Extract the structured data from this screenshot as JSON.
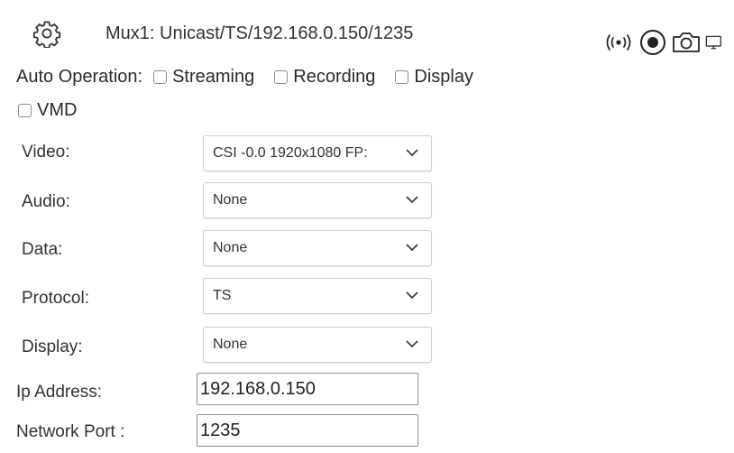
{
  "header": {
    "title": "Mux1: Unicast/TS/192.168.0.150/1235",
    "settings_icon": "gear-icon",
    "status_icons": [
      "broadcast-icon",
      "record-icon",
      "camera-icon",
      "monitor-icon"
    ]
  },
  "auto_operation": {
    "label": "Auto Operation:",
    "options": [
      {
        "label": "Streaming",
        "checked": false
      },
      {
        "label": "Recording",
        "checked": false
      },
      {
        "label": "Display",
        "checked": false
      },
      {
        "label": "VMD",
        "checked": false
      }
    ]
  },
  "fields": {
    "video": {
      "label": "Video:",
      "value": "CSI -0.0 1920x1080 FP:"
    },
    "audio": {
      "label": "Audio:",
      "value": "None"
    },
    "data": {
      "label": "Data:",
      "value": "None"
    },
    "protocol": {
      "label": "Protocol:",
      "value": "TS"
    },
    "display": {
      "label": "Display:",
      "value": "None"
    },
    "ip_address": {
      "label": "Ip Address:",
      "value": "192.168.0.150"
    },
    "network_port": {
      "label": "Network Port :",
      "value": "1235"
    }
  }
}
